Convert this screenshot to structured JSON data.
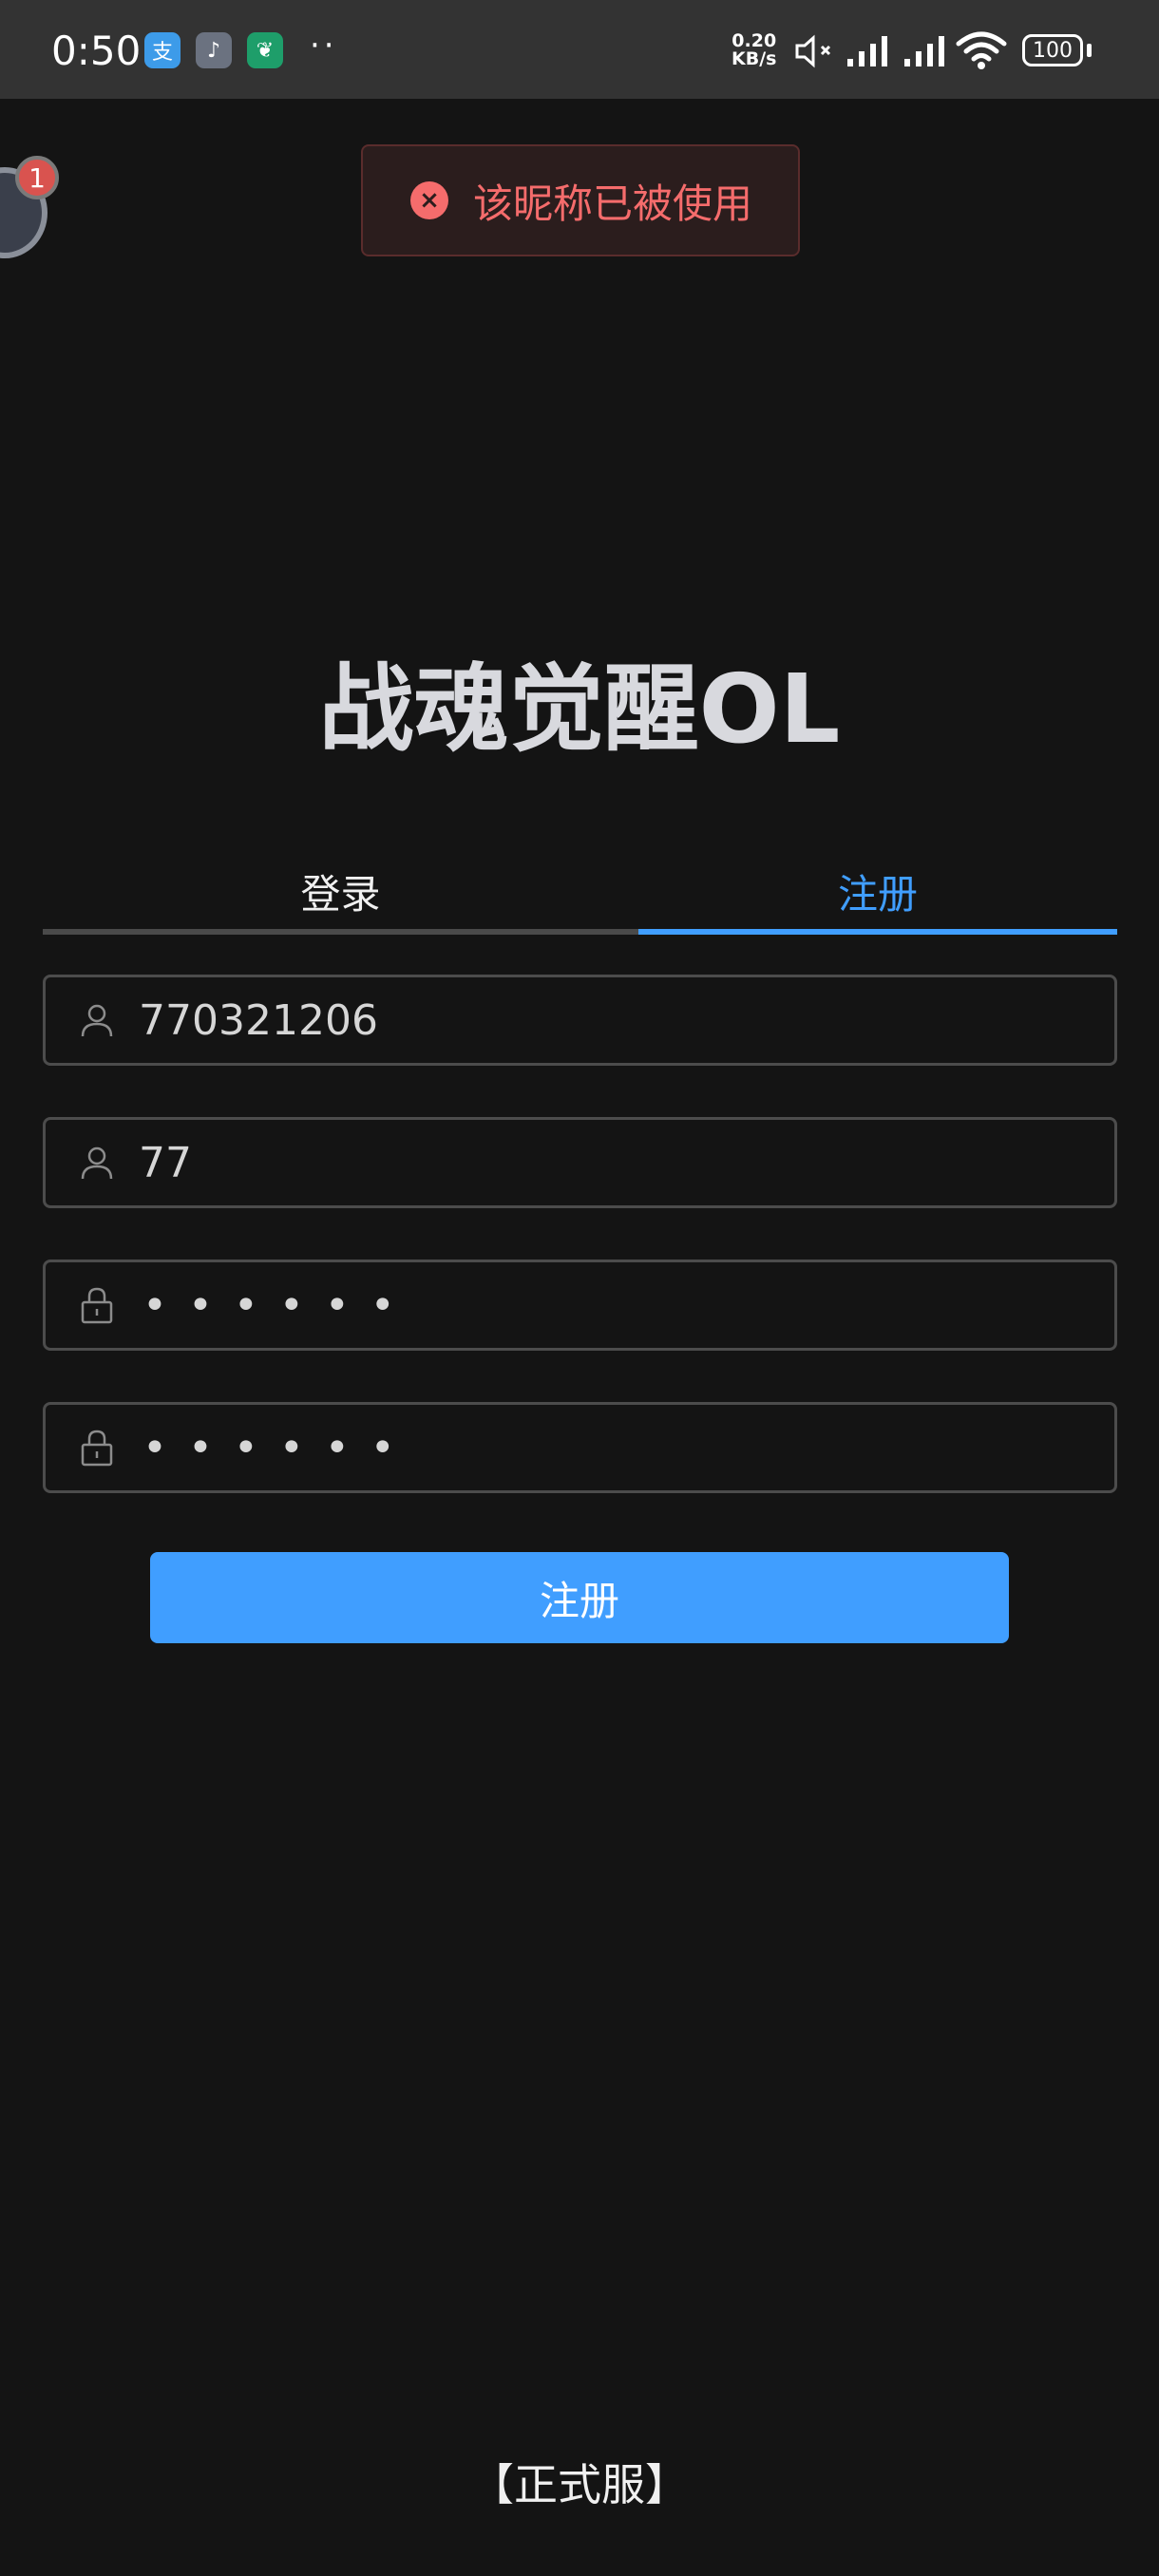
{
  "status_bar": {
    "time": "0:50",
    "apps": [
      {
        "icon": "alipay-icon",
        "glyph": "支",
        "color": "#3d9be9"
      },
      {
        "icon": "music-app-icon",
        "glyph": "♪",
        "color": "#6b7280"
      },
      {
        "icon": "leaf-app-icon",
        "glyph": "❦",
        "color": "#1e9e6a"
      }
    ],
    "more": "··",
    "net_speed_value": "0.20",
    "net_speed_unit": "KB/s",
    "battery": "100"
  },
  "float_badge": {
    "count": "1"
  },
  "toast": {
    "message": "该昵称已被使用",
    "icon": "error-circle-icon",
    "color": "#f56c6c"
  },
  "title": "战魂觉醒OL",
  "tabs": {
    "login": "登录",
    "register": "注册",
    "active": "register",
    "accent": "#409eff"
  },
  "form": {
    "account": "770321206",
    "nickname": "77",
    "password_mask": "••••••",
    "confirm_mask": "••••••"
  },
  "register_button": "注册",
  "footer": "【正式服】"
}
